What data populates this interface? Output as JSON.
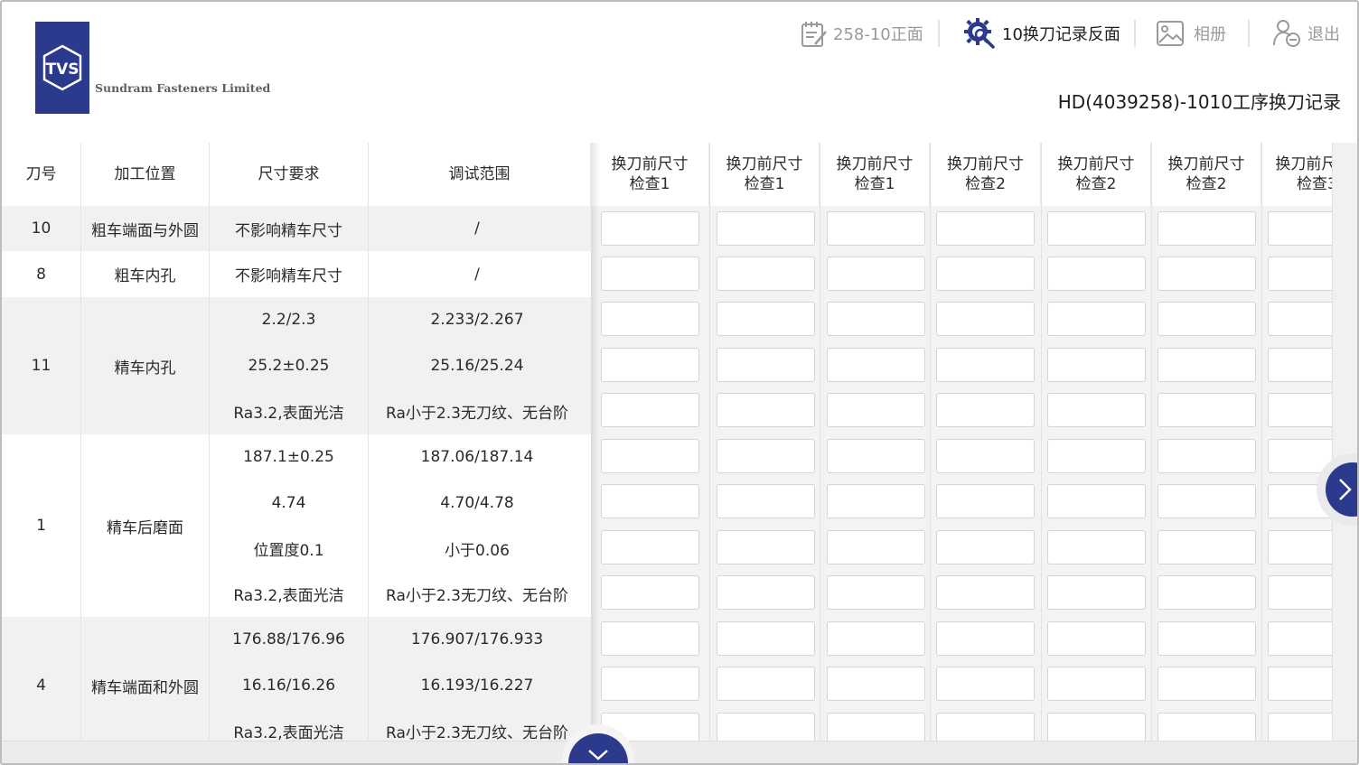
{
  "brand": {
    "logo_text": "TVS",
    "company_name": "Sundram Fasteners Limited",
    "accent": "#2b3a8c"
  },
  "nav": [
    {
      "label": "258-10正面",
      "icon": "notepad-icon",
      "active": false
    },
    {
      "label": "10换刀记录反面",
      "icon": "gear-search-icon",
      "active": true
    },
    {
      "label": "相册",
      "icon": "photo-album-icon",
      "active": false
    },
    {
      "label": "退出",
      "icon": "logout-icon",
      "active": false
    }
  ],
  "sheet_title": "HD(4039258)-1010工序换刀记录",
  "table": {
    "headers": {
      "tool_no": "刀号",
      "position": "加工位置",
      "requirement": "尺寸要求",
      "range": "调试范围"
    },
    "check_headers": [
      {
        "line1": "换刀前尺寸",
        "line2": "检查1"
      },
      {
        "line1": "换刀前尺寸",
        "line2": "检查1"
      },
      {
        "line1": "换刀前尺寸",
        "line2": "检查1"
      },
      {
        "line1": "换刀前尺寸",
        "line2": "检查2"
      },
      {
        "line1": "换刀前尺寸",
        "line2": "检查2"
      },
      {
        "line1": "换刀前尺寸",
        "line2": "检查2"
      },
      {
        "line1": "换刀前尺",
        "line2": "检查3"
      }
    ],
    "groups": [
      {
        "tool": "10",
        "position": "粗车端面与外圆",
        "rows": [
          {
            "requirement": "不影响精车尺寸",
            "range": "/"
          }
        ]
      },
      {
        "tool": "8",
        "position": "粗车内孔",
        "rows": [
          {
            "requirement": "不影响精车尺寸",
            "range": "/"
          }
        ]
      },
      {
        "tool": "11",
        "position": "精车内孔",
        "rows": [
          {
            "requirement": "2.2/2.3",
            "range": "2.233/2.267"
          },
          {
            "requirement": "25.2±0.25",
            "range": "25.16/25.24"
          },
          {
            "requirement": "Ra3.2,表面光洁",
            "range": "Ra小于2.3无刀纹、无台阶"
          }
        ]
      },
      {
        "tool": "1",
        "position": "精车后磨面",
        "rows": [
          {
            "requirement": "187.1±0.25",
            "range": "187.06/187.14"
          },
          {
            "requirement": "4.74",
            "range": "4.70/4.78"
          },
          {
            "requirement": "位置度0.1",
            "range": "小于0.06"
          },
          {
            "requirement": "Ra3.2,表面光洁",
            "range": "Ra小于2.3无刀纹、无台阶"
          }
        ]
      },
      {
        "tool": "4",
        "position": "精车端面和外圆",
        "rows": [
          {
            "requirement": "176.88/176.96",
            "range": "176.907/176.933"
          },
          {
            "requirement": "16.16/16.26",
            "range": "16.193/16.227"
          },
          {
            "requirement": "Ra3.2,表面光洁",
            "range": "Ra小于2.3无刀纹、无台阶"
          }
        ]
      }
    ]
  }
}
